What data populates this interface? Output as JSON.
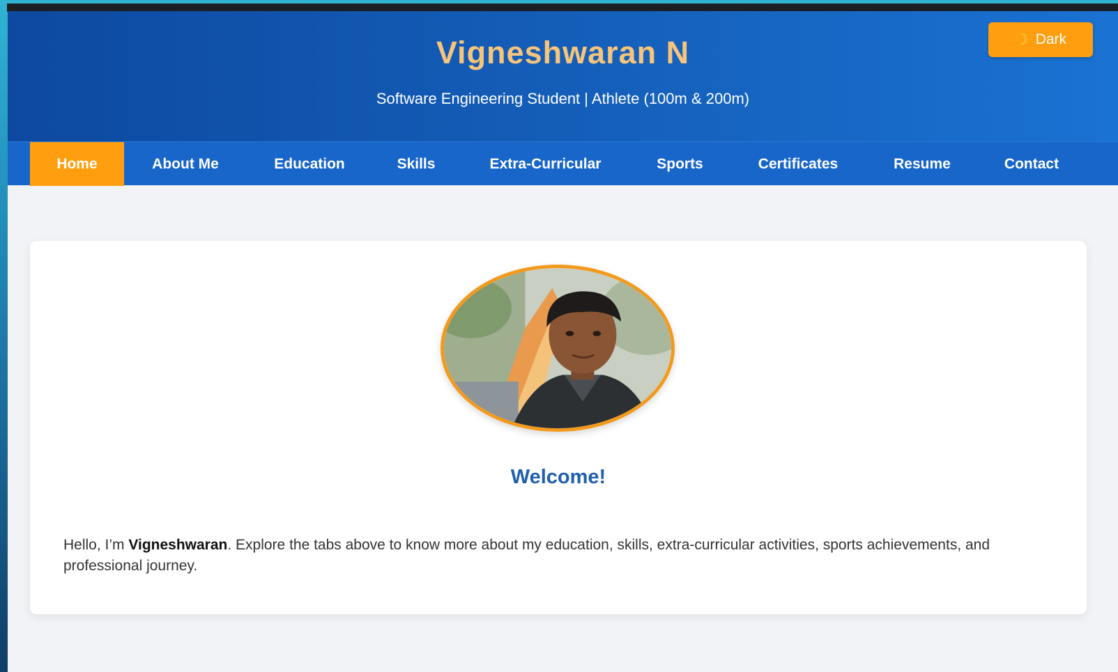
{
  "header": {
    "title": "Vigneshwaran N",
    "subtitle": "Software Engineering Student | Athlete (100m & 200m)",
    "theme_toggle": {
      "icon": "moon-icon",
      "label": "Dark"
    }
  },
  "nav": {
    "items": [
      {
        "label": "Home",
        "active": true
      },
      {
        "label": "About Me"
      },
      {
        "label": "Education"
      },
      {
        "label": "Skills"
      },
      {
        "label": "Extra-Curricular"
      },
      {
        "label": "Sports"
      },
      {
        "label": "Certificates"
      },
      {
        "label": "Resume"
      },
      {
        "label": "Contact"
      }
    ]
  },
  "main": {
    "heading": "Welcome!",
    "intro_prefix": "Hello, I’m ",
    "intro_name": "Vigneshwaran",
    "intro_suffix": ". Explore the tabs above to know more about my education, skills, extra-curricular activities, sports achievements, and professional journey."
  },
  "colors": {
    "header_bg": "#1560bb",
    "accent": "#ff9f0f",
    "title": "#f6c47a",
    "heading": "#1f5fae"
  }
}
